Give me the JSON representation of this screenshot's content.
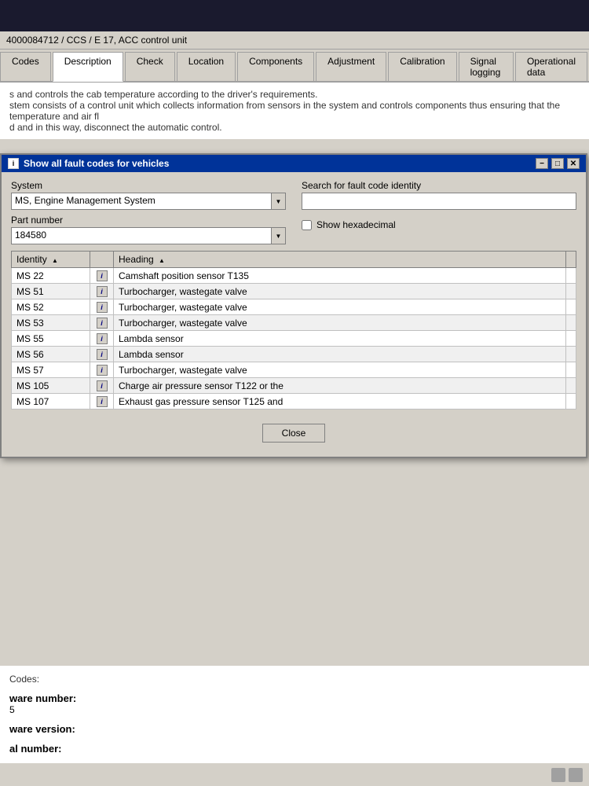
{
  "topbar": {},
  "breadcrumb": {
    "text": "4000084712  /  CCS  /  E 17, ACC control unit"
  },
  "tabs": [
    {
      "id": "codes",
      "label": "Codes",
      "active": false
    },
    {
      "id": "description",
      "label": "Description",
      "active": true
    },
    {
      "id": "check",
      "label": "Check",
      "active": false
    },
    {
      "id": "location",
      "label": "Location",
      "active": false
    },
    {
      "id": "components",
      "label": "Components",
      "active": false
    },
    {
      "id": "adjustment",
      "label": "Adjustment",
      "active": false
    },
    {
      "id": "calibration",
      "label": "Calibration",
      "active": false
    },
    {
      "id": "signal_logging",
      "label": "Signal logging",
      "active": false
    },
    {
      "id": "operational_data",
      "label": "Operational data",
      "active": false
    }
  ],
  "bg_description": {
    "line1": "s and controls the cab temperature according to the driver's requirements.",
    "line2": "stem consists of a control unit which collects information from sensors in the system and controls components thus ensuring that the temperature and air fl",
    "line3": "d and in this way, disconnect the automatic control."
  },
  "modal": {
    "title": "Show all fault codes for vehicles",
    "controls": {
      "minimize": "−",
      "maximize": "□",
      "close": "✕"
    },
    "system_label": "System",
    "system_value": "MS, Engine Management System",
    "part_number_label": "Part number",
    "part_number_value": "184580",
    "search_label": "Search for fault code identity",
    "search_placeholder": "",
    "show_hexadecimal_label": "Show hexadecimal",
    "table": {
      "columns": [
        {
          "id": "identity",
          "label": "Identity",
          "sortable": true
        },
        {
          "id": "icon",
          "label": "",
          "sortable": false
        },
        {
          "id": "heading",
          "label": "Heading",
          "sortable": true
        },
        {
          "id": "extra",
          "label": "",
          "sortable": false
        }
      ],
      "rows": [
        {
          "identity": "MS 22",
          "heading": "Camshaft position sensor T135"
        },
        {
          "identity": "MS 51",
          "heading": "Turbocharger, wastegate valve"
        },
        {
          "identity": "MS 52",
          "heading": "Turbocharger, wastegate valve"
        },
        {
          "identity": "MS 53",
          "heading": "Turbocharger, wastegate valve"
        },
        {
          "identity": "MS 55",
          "heading": "Lambda sensor"
        },
        {
          "identity": "MS 56",
          "heading": "Lambda sensor"
        },
        {
          "identity": "MS 57",
          "heading": "Turbocharger, wastegate valve"
        },
        {
          "identity": "MS 105",
          "heading": "Charge air pressure sensor T122 or the"
        },
        {
          "identity": "MS 107",
          "heading": "Exhaust gas pressure sensor T125 and"
        }
      ]
    },
    "close_button": "Close"
  },
  "bg_bottom": {
    "codes_label": "Codes:",
    "software_number_label": "ware number:",
    "software_number_value": "5",
    "software_version_label": "ware version:",
    "serial_number_label": "al number:"
  }
}
